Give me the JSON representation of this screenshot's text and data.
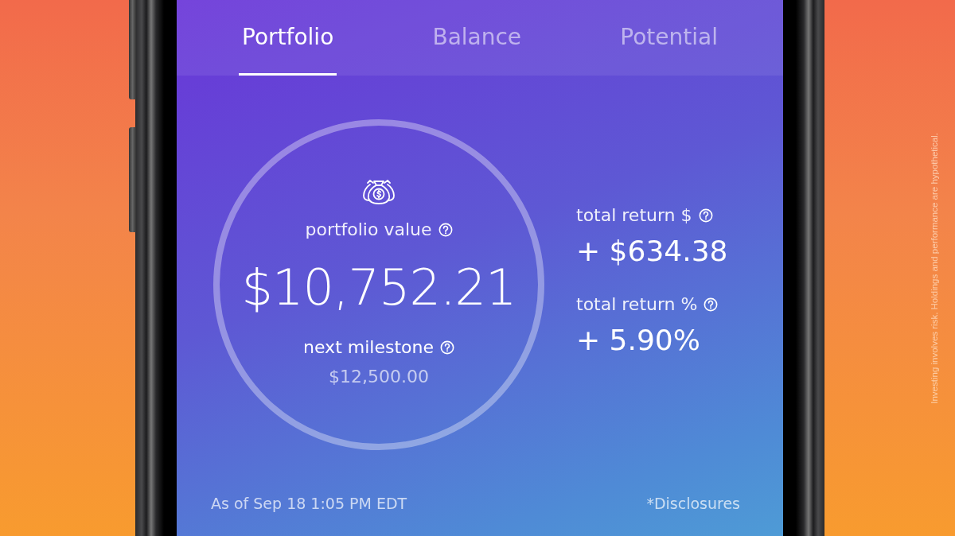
{
  "tabs": [
    {
      "label": "Portfolio",
      "selected": true
    },
    {
      "label": "Balance",
      "selected": false
    },
    {
      "label": "Potential",
      "selected": false
    }
  ],
  "portfolio": {
    "label": "portfolio value",
    "value": "$10,752.21",
    "milestone_label": "next milestone",
    "milestone_value": "$12,500.00"
  },
  "returns": [
    {
      "label": "total return $",
      "value": "+ $634.38"
    },
    {
      "label": "total return %",
      "value": "+ 5.90%"
    }
  ],
  "as_of": "As of Sep 18 1:05 PM EDT",
  "disclosures_link": "*Disclosures",
  "side_note": "Investing involves risk. Holdings and performance are hypothetical."
}
